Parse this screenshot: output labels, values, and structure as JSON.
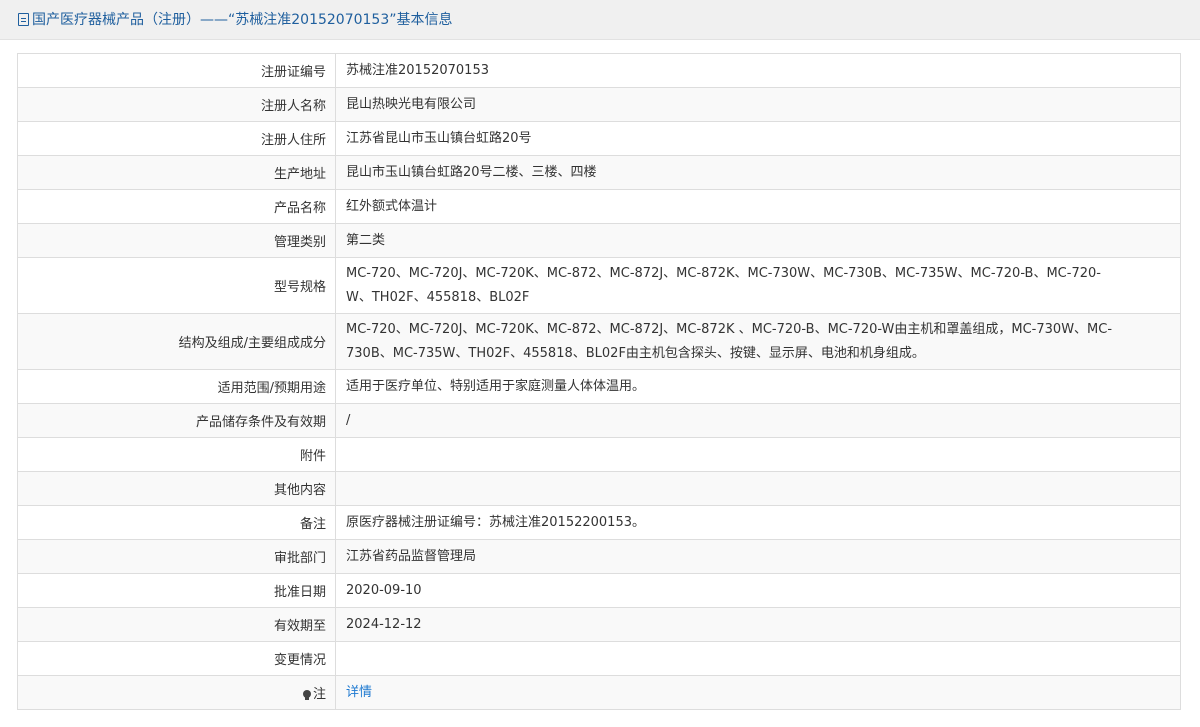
{
  "header": {
    "title": "国产医疗器械产品（注册）——“苏械注准20152070153”基本信息",
    "icon": "document-icon"
  },
  "rows": [
    {
      "label": "注册证编号",
      "value": [
        "苏械注准20152070153"
      ]
    },
    {
      "label": "注册人名称",
      "value": [
        "昆山热映光电有限公司"
      ]
    },
    {
      "label": "注册人住所",
      "value": [
        "江苏省昆山市玉山镇台虹路20号"
      ]
    },
    {
      "label": "生产地址",
      "value": [
        "昆山市玉山镇台虹路20号二楼、三楼、四楼"
      ]
    },
    {
      "label": "产品名称",
      "value": [
        "红外额式体温计"
      ]
    },
    {
      "label": "管理类别",
      "value": [
        "第二类"
      ]
    },
    {
      "label": "型号规格",
      "value": [
        "MC-720、MC-720J、MC-720K、MC-872、MC-872J、MC-872K、MC-730W、MC-730B、MC-735W、MC-720-B、MC-720-",
        "W、TH02F、455818、BL02F"
      ]
    },
    {
      "label": "结构及组成/主要组成成分",
      "value": [
        "MC-720、MC-720J、MC-720K、MC-872、MC-872J、MC-872K 、MC-720-B、MC-720-W由主机和罩盖组成，MC-730W、MC-",
        "730B、MC-735W、TH02F、455818、BL02F由主机包含探头、按键、显示屏、电池和机身组成。"
      ]
    },
    {
      "label": "适用范围/预期用途",
      "value": [
        "适用于医疗单位、特别适用于家庭测量人体体温用。"
      ]
    },
    {
      "label": "产品储存条件及有效期",
      "value": [
        "/"
      ]
    },
    {
      "label": "附件",
      "value": [
        ""
      ]
    },
    {
      "label": "其他内容",
      "value": [
        ""
      ]
    },
    {
      "label": "备注",
      "value": [
        "原医疗器械注册证编号：苏械注准20152200153。"
      ]
    },
    {
      "label": "审批部门",
      "value": [
        "江苏省药品监督管理局"
      ]
    },
    {
      "label": "批准日期",
      "value": [
        "2020-09-10"
      ]
    },
    {
      "label": "有效期至",
      "value": [
        "2024-12-12"
      ]
    },
    {
      "label": "变更情况",
      "value": [
        ""
      ]
    }
  ],
  "note": {
    "label": "注",
    "icon": "lightbulb-icon",
    "link_text": "详情"
  },
  "colors": {
    "title": "#1f5f9e",
    "link": "#1f7ad1",
    "border": "#dddddd",
    "stripe": "#f9f9f9",
    "header_bg": "#f0f0f0"
  }
}
